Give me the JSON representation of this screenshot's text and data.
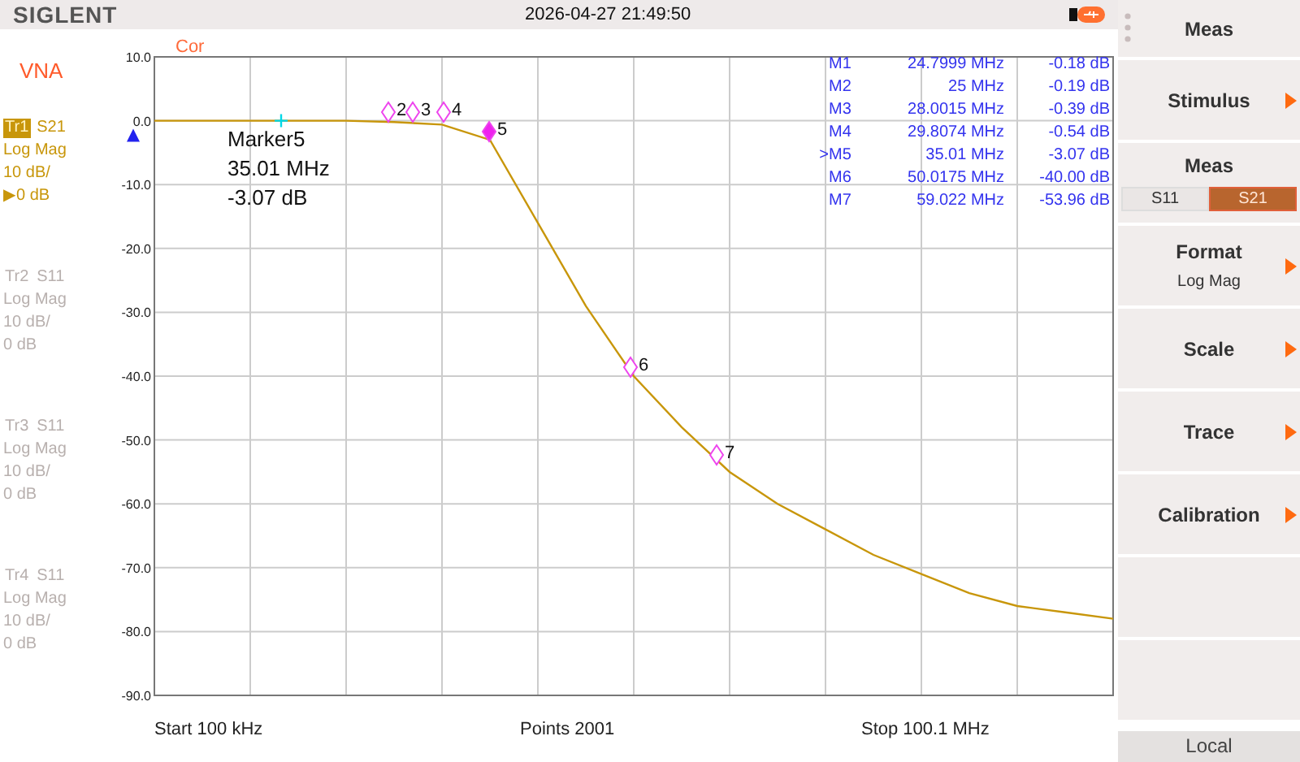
{
  "header": {
    "brand": "SIGLENT",
    "datetime": "2026-04-27 21:49:50"
  },
  "mode": "VNA",
  "traces": [
    {
      "name": "Tr1",
      "param": "S21",
      "format": "Log Mag",
      "scale": "10 dB/",
      "ref": "▶0 dB",
      "active": true
    },
    {
      "name": "Tr2",
      "param": "S11",
      "format": "Log Mag",
      "scale": "10 dB/",
      "ref": "0 dB",
      "active": false
    },
    {
      "name": "Tr3",
      "param": "S11",
      "format": "Log Mag",
      "scale": "10 dB/",
      "ref": "0 dB",
      "active": false
    },
    {
      "name": "Tr4",
      "param": "S11",
      "format": "Log Mag",
      "scale": "10 dB/",
      "ref": "0 dB",
      "active": false
    }
  ],
  "plot": {
    "status": "Cor",
    "readout": [
      "Marker5",
      "35.01 MHz",
      "-3.07 dB"
    ],
    "marker_table": [
      {
        "name": "M1",
        "freq": "24.7999 MHz",
        "value": "-0.18 dB",
        "selected": false
      },
      {
        "name": "M2",
        "freq": "25 MHz",
        "value": "-0.19 dB",
        "selected": false
      },
      {
        "name": "M3",
        "freq": "28.0015 MHz",
        "value": "-0.39 dB",
        "selected": false
      },
      {
        "name": "M4",
        "freq": "29.8074 MHz",
        "value": "-0.54 dB",
        "selected": false
      },
      {
        "name": "M5",
        "freq": "35.01 MHz",
        "value": "-3.07 dB",
        "selected": true
      },
      {
        "name": "M6",
        "freq": "50.0175 MHz",
        "value": "-40.00 dB",
        "selected": false
      },
      {
        "name": "M7",
        "freq": "59.022 MHz",
        "value": "-53.96 dB",
        "selected": false
      }
    ],
    "active_pointer": ">",
    "markers": [
      {
        "label": "2",
        "selected": false
      },
      {
        "label": "3",
        "selected": false
      },
      {
        "label": "4",
        "selected": false
      },
      {
        "label": "5",
        "selected": true
      },
      {
        "label": "6",
        "selected": false
      },
      {
        "label": "7",
        "selected": false
      }
    ],
    "chart_data": {
      "type": "line",
      "ylim": [
        -90,
        10
      ],
      "grid": true,
      "yticks": [
        {
          "value": 10,
          "label": "10.0"
        },
        {
          "value": 0,
          "label": "0.0"
        },
        {
          "value": -10,
          "label": "-10.0"
        },
        {
          "value": -20,
          "label": "-20.0"
        },
        {
          "value": -30,
          "label": "-30.0"
        },
        {
          "value": -40,
          "label": "-40.0"
        },
        {
          "value": -50,
          "label": "-50.0"
        },
        {
          "value": -60,
          "label": "-60.0"
        },
        {
          "value": -70,
          "label": "-70.0"
        },
        {
          "value": -80,
          "label": "-80.0"
        },
        {
          "value": -90,
          "label": "-90.0"
        }
      ],
      "categories": [
        null,
        null,
        null,
        null,
        null,
        null,
        null,
        null,
        null,
        null,
        null,
        null,
        null,
        null,
        null,
        null,
        null,
        null,
        null,
        null,
        null
      ],
      "series": [
        {
          "color": "#c8960a",
          "values": [
            0,
            0,
            0,
            0,
            0,
            -0.2,
            -0.6,
            -3,
            -16,
            -29,
            -40,
            -48,
            -55,
            -60,
            -64,
            -68,
            -71,
            -74,
            -76,
            -77,
            -78
          ]
        }
      ]
    }
  },
  "footer": {
    "start": "Start  100 kHz",
    "points": "Points  2001",
    "stop": "Stop  100.1 MHz"
  },
  "menu": [
    {
      "kind": "title",
      "label": "Meas"
    },
    {
      "kind": "submenu",
      "label": "Stimulus"
    },
    {
      "kind": "toggle",
      "label": "Meas",
      "options": [
        {
          "label": "S11",
          "selected": false
        },
        {
          "label": "S21",
          "selected": true
        }
      ]
    },
    {
      "kind": "submenu",
      "label": "Format",
      "value": "Log Mag"
    },
    {
      "kind": "submenu",
      "label": "Scale"
    },
    {
      "kind": "submenu",
      "label": "Trace"
    },
    {
      "kind": "submenu",
      "label": "Calibration"
    },
    {
      "kind": "empty"
    },
    {
      "kind": "empty"
    }
  ],
  "status": "Local"
}
